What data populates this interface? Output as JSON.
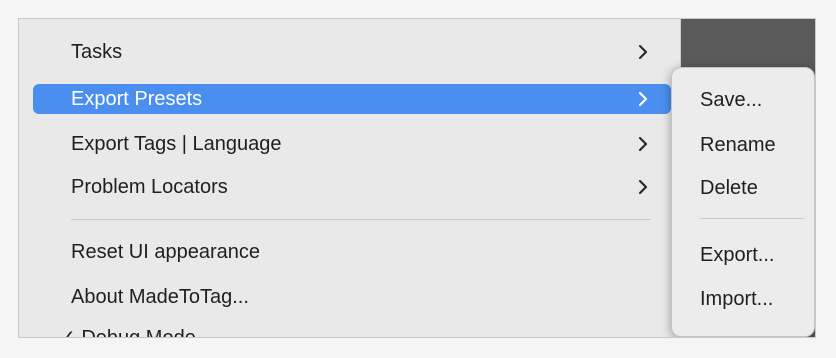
{
  "menu": {
    "items": [
      {
        "label": "Tasks",
        "has_submenu": true,
        "active": false
      },
      {
        "label": "Export Presets",
        "has_submenu": true,
        "active": true
      },
      {
        "label": "Export Tags | Language",
        "has_submenu": true,
        "active": false
      },
      {
        "label": "Problem Locators",
        "has_submenu": true,
        "active": false
      },
      {
        "label": "Reset UI appearance",
        "has_submenu": false,
        "active": false
      },
      {
        "label": "About MadeToTag...",
        "has_submenu": false,
        "active": false
      }
    ],
    "partial_item_label": "✓ Debug Mode"
  },
  "submenu": {
    "items": [
      {
        "label": "Save..."
      },
      {
        "label": "Rename"
      },
      {
        "label": "Delete"
      },
      {
        "label": "Export..."
      },
      {
        "label": "Import..."
      }
    ]
  },
  "colors": {
    "highlight": "#4a8ff0",
    "menu_bg": "#e9e9e9",
    "dark_bg": "#5a5a5a"
  },
  "icons": {
    "submenu_indicator": "chevron-right-icon"
  }
}
